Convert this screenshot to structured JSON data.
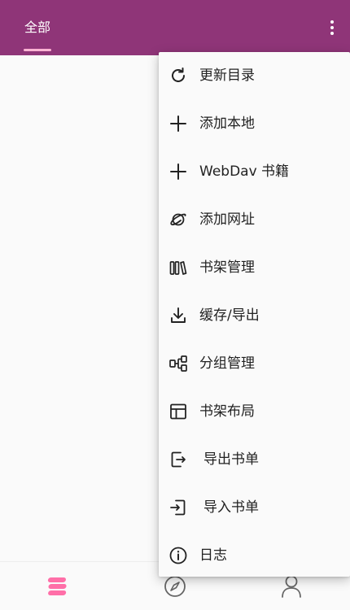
{
  "appbar": {
    "tab_all": "全部",
    "colors": {
      "bar": "#8f3578",
      "indicator": "#ffb3d4"
    }
  },
  "menu": {
    "items": [
      {
        "label": "更新目录",
        "icon": "refresh-icon"
      },
      {
        "label": "添加本地",
        "icon": "plus-icon"
      },
      {
        "label": "WebDav 书籍",
        "icon": "plus-icon"
      },
      {
        "label": "添加网址",
        "icon": "planet-icon"
      },
      {
        "label": "书架管理",
        "icon": "books-icon"
      },
      {
        "label": "缓存/导出",
        "icon": "download-icon"
      },
      {
        "label": "分组管理",
        "icon": "group-icon"
      },
      {
        "label": "书架布局",
        "icon": "layout-icon"
      },
      {
        "label": "导出书单",
        "icon": "export-icon"
      },
      {
        "label": "导入书单",
        "icon": "import-icon"
      },
      {
        "label": "日志",
        "icon": "info-icon"
      }
    ]
  },
  "bottomnav": {
    "items": [
      {
        "icon": "bookshelf-icon",
        "active": true
      },
      {
        "icon": "compass-icon",
        "active": false
      },
      {
        "icon": "person-icon",
        "active": false
      }
    ],
    "active_color": "#ff6fa8"
  }
}
